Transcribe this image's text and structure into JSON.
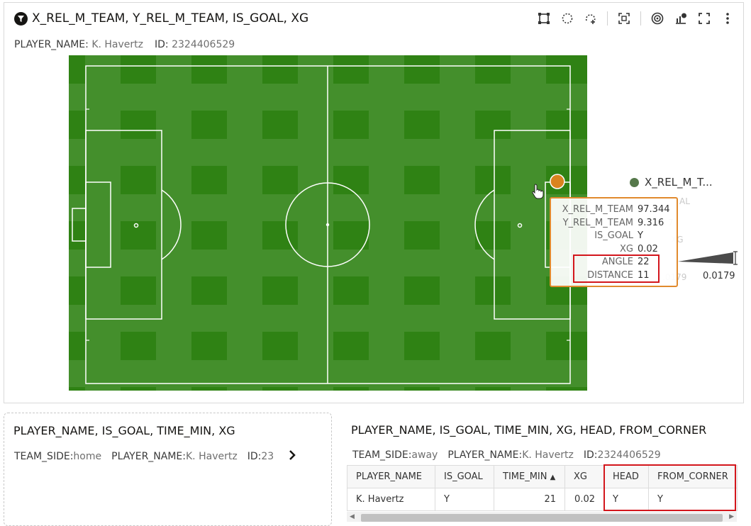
{
  "top_panel": {
    "title": "X_REL_M_TEAM, Y_REL_M_TEAM, IS_GOAL, XG",
    "filters": [
      {
        "key": "PLAYER_NAME:",
        "value": "K. Havertz"
      },
      {
        "key": "ID:",
        "value": "2324406529"
      }
    ],
    "toolbar_icons": [
      "rectangle-select-icon",
      "lasso-select-icon",
      "lasso-add-icon",
      "zoom-fit-icon",
      "target-icon",
      "chart-options-icon",
      "fullscreen-icon",
      "more-options-icon"
    ],
    "legend_label": "X_REL_M_T...",
    "ghost_texts": [
      "AL",
      "XG",
      "7",
      ".0179"
    ],
    "bar_value_label": "0.0179",
    "point": {
      "x": 97.344,
      "y": 9.316
    },
    "tooltip": [
      {
        "key": "X_REL_M_TEAM",
        "value": "97.344"
      },
      {
        "key": "Y_REL_M_TEAM",
        "value": "9.316"
      },
      {
        "key": "IS_GOAL",
        "value": "Y"
      },
      {
        "key": "XG",
        "value": "0.02"
      },
      {
        "key": "ANGLE",
        "value": "22"
      },
      {
        "key": "DISTANCE",
        "value": "11"
      }
    ],
    "colors": {
      "pitch": "#2f8214",
      "point": "#d9831e",
      "legend": "#55784a",
      "highlight": "#d3161c"
    }
  },
  "bottom_left": {
    "title": "PLAYER_NAME, IS_GOAL, TIME_MIN, XG",
    "filters": [
      {
        "key": "TEAM_SIDE:",
        "value": "home"
      },
      {
        "key": "PLAYER_NAME:",
        "value": "K. Havertz"
      },
      {
        "key": "ID:",
        "value": "23"
      }
    ]
  },
  "bottom_right": {
    "title": "PLAYER_NAME, IS_GOAL, TIME_MIN, XG, HEAD, FROM_CORNER",
    "filters": [
      {
        "key": "TEAM_SIDE:",
        "value": "away"
      },
      {
        "key": "PLAYER_NAME:",
        "value": "K. Havertz"
      },
      {
        "key": "ID:",
        "value": "2324406529"
      }
    ],
    "columns": [
      "PLAYER_NAME",
      "IS_GOAL",
      "TIME_MIN",
      "XG",
      "HEAD",
      "FROM_CORNER"
    ],
    "rows": [
      [
        "K. Havertz",
        "Y",
        "21",
        "0.02",
        "Y",
        "Y"
      ]
    ]
  }
}
